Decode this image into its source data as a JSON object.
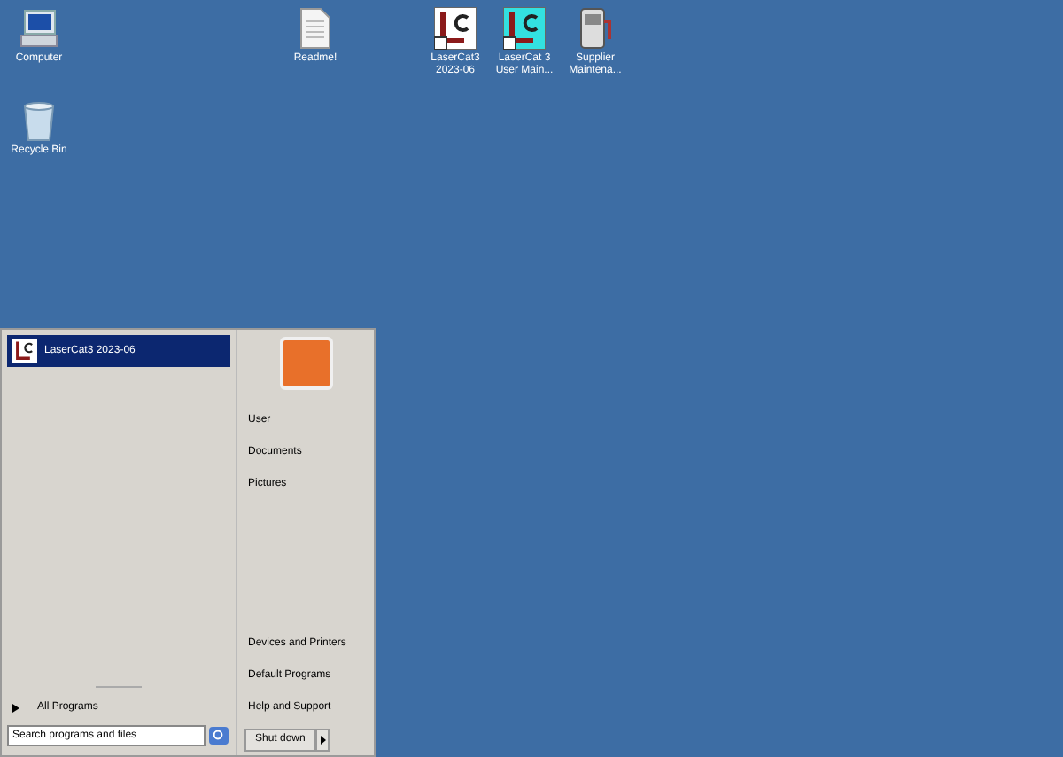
{
  "desktop_icons": [
    {
      "label": "Computer",
      "kind": "computer"
    },
    {
      "label": "Readme!",
      "kind": "document"
    },
    {
      "label": "LaserCat3\n2023-06",
      "kind": "lc"
    },
    {
      "label": "LaserCat 3\nUser Main...",
      "kind": "lc-cyan"
    },
    {
      "label": "Supplier\nMaintena...",
      "kind": "pump"
    },
    {
      "label": "Recycle Bin",
      "kind": "bin"
    }
  ],
  "start_menu": {
    "pinned": [
      {
        "label": "LaserCat3 2023-06",
        "selected": true
      }
    ],
    "all_programs": "All Programs",
    "search": {
      "placeholder": "Search programs and files"
    },
    "right_items": [
      "User",
      "Documents",
      "Pictures",
      "Devices and Printers",
      "Default Programs",
      "Help and Support"
    ],
    "shutdown": "Shut down"
  }
}
